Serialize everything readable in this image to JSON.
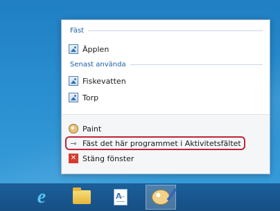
{
  "jumplist": {
    "pinned_header": "Fäst",
    "pinned_items": [
      {
        "label": "Äpplen",
        "icon": "image-icon"
      }
    ],
    "recent_header": "Senast använda",
    "recent_items": [
      {
        "label": "Fiskevatten",
        "icon": "image-icon"
      },
      {
        "label": "Torp",
        "icon": "image-icon"
      }
    ],
    "tasks": {
      "app_label": "Paint",
      "pin_label": "Fäst det här programmet i Aktivitetsfältet",
      "close_label": "Stäng fönster"
    }
  },
  "colors": {
    "highlight_border": "#c2233a",
    "header_text": "#1d5fa6",
    "taskbar": "#1b5f9a"
  },
  "taskbar": {
    "buttons": [
      {
        "name": "internet-explorer",
        "icon": "ie-icon"
      },
      {
        "name": "file-explorer",
        "icon": "folder-icon"
      },
      {
        "name": "wordpad",
        "icon": "wordpad-icon"
      },
      {
        "name": "paint",
        "icon": "paint-icon",
        "active": true
      }
    ]
  }
}
